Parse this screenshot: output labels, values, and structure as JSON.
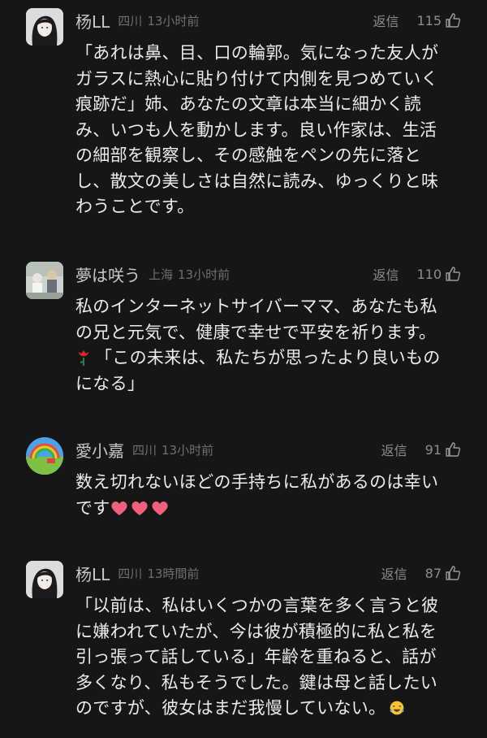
{
  "comments": [
    {
      "name": "杨LL",
      "location": "四川",
      "time": "13小时前",
      "reply": "返信",
      "likes": "115",
      "text": "「あれは鼻、目、口の輪郭。気になった友人が\nガラスに熱心に貼り付けて内側を見つめていく\n痕跡だ」姉、あなたの文章は本当に細かく読\nみ、いつも人を動かします。良い作家は、生活\nの細部を観察し、その感触をペンの先に落と\nし、散文の美しさは自然に読み、ゆっくりと味\nわうことです。"
    },
    {
      "name": "夢は咲う",
      "location": "上海",
      "time": "13小时前",
      "reply": "返信",
      "likes": "110",
      "text_a": "私のインターネットサイバーママ、あなたも私\nの兄と元気で、健康で幸せで平安を祈ります。\n",
      "emoji": "rose",
      "text_b": "「この未来は、私たちが思ったより良いもの\nになる」"
    },
    {
      "name": "愛小嘉",
      "location": "四川",
      "time": "13小时前",
      "reply": "返信",
      "likes": "91",
      "text": "数え切れないほどの手持ちに私があるのは幸い\nです",
      "emoji": "heart x3"
    },
    {
      "name": "杨LL",
      "location": "四川",
      "time": "13時間前",
      "reply": "返信",
      "likes": "87",
      "text": "「以前は、私はいくつかの言葉を多く言うと彼\nに嫌われていたが、今は彼が積極的に私と私を\n引っ張って話している」年齢を重ねると、話が\n多くなり、私もそうでした。鍵は母と話したい\nのですが、彼女はまだ我慢していない。",
      "emoji": "crying-laughing"
    }
  ]
}
